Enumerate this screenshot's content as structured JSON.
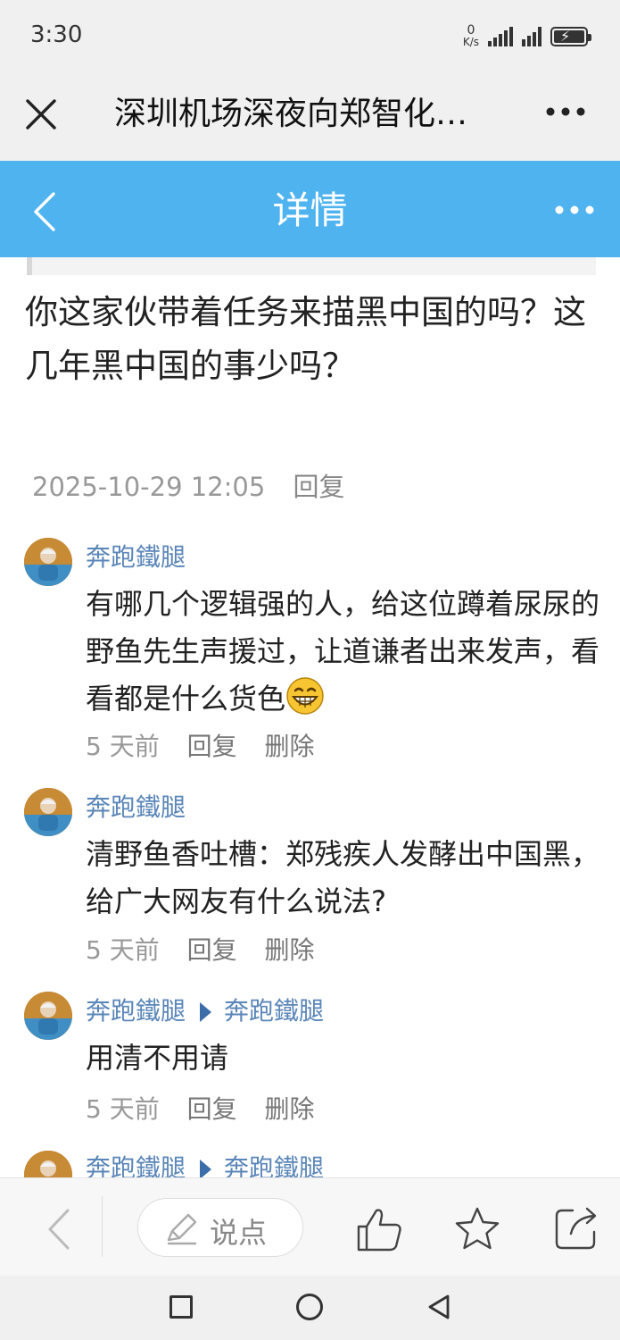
{
  "status_bar": {
    "time": "3:30",
    "net_speed_value": "0",
    "net_speed_unit": "K/s"
  },
  "nav": {
    "title": "深圳机场深夜向郑智化…"
  },
  "header": {
    "title": "详情"
  },
  "main_comment": {
    "text": "你这家伙带着任务来描黑中国的吗？这几年黑中国的事少吗？",
    "timestamp": "2025-10-29 12:05",
    "reply_label": "回复"
  },
  "replies": [
    {
      "author": "奔跑鐵腿",
      "text": "有哪几个逻辑强的人，给这位蹲着尿尿的野鱼先生声援过，让道谦者出来发声，看看都是什么货色",
      "time": "5 天前",
      "reply_label": "回复",
      "delete_label": "删除"
    },
    {
      "author": "奔跑鐵腿",
      "text": "清野鱼香吐槽：郑残疾人发酵出中国黑，给广大网友有什么说法?",
      "time": "5 天前",
      "reply_label": "回复",
      "delete_label": "删除"
    },
    {
      "author": "奔跑鐵腿",
      "reply_to": "奔跑鐵腿",
      "text": "用清不用请",
      "time": "5 天前",
      "reply_label": "回复",
      "delete_label": "删除"
    },
    {
      "author": "奔跑鐵腿",
      "reply_to": "奔跑鐵腿"
    }
  ],
  "bottom_bar": {
    "comment_placeholder": "说点"
  },
  "colors": {
    "header_blue": "#4eb3ef",
    "author_blue": "#5a86b8",
    "meta_gray": "#999999"
  }
}
